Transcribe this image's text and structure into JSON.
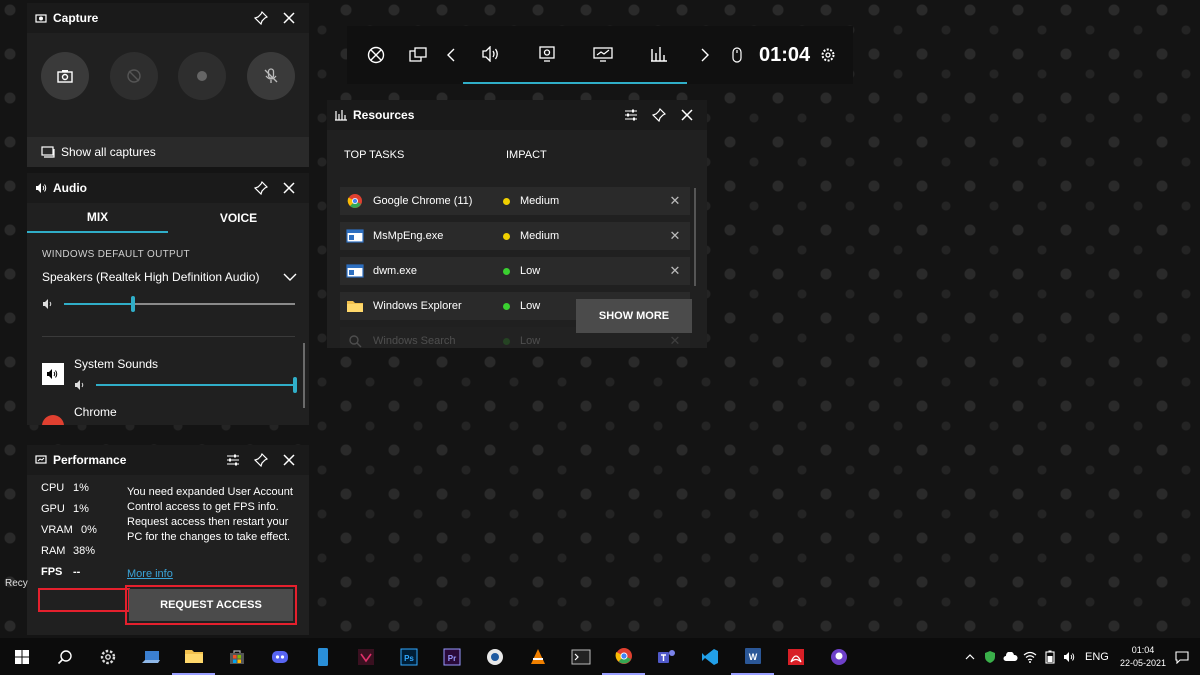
{
  "capture": {
    "title": "Capture",
    "show_all_label": "Show all captures"
  },
  "audio": {
    "title": "Audio",
    "tabs": [
      "MIX",
      "VOICE"
    ],
    "default_output_label": "WINDOWS DEFAULT OUTPUT",
    "device": "Speakers (Realtek High Definition Audio)",
    "master_volume": 0.3,
    "apps": [
      {
        "name": "System Sounds",
        "volume": 1.0
      },
      {
        "name": "Chrome"
      }
    ]
  },
  "performance": {
    "title": "Performance",
    "stats": [
      {
        "label": "CPU",
        "value": "1%"
      },
      {
        "label": "GPU",
        "value": "1%"
      },
      {
        "label": "VRAM",
        "value": "0%"
      },
      {
        "label": "RAM",
        "value": "38%"
      },
      {
        "label": "FPS",
        "value": "--"
      }
    ],
    "message": "You need expanded User Account Control access to get FPS info. Request access then restart your PC for the changes to take effect.",
    "more_info": "More info",
    "request_access": "REQUEST ACCESS"
  },
  "gamebar": {
    "time": "01:04"
  },
  "resources": {
    "title": "Resources",
    "col_tasks": "TOP TASKS",
    "col_impact": "IMPACT",
    "rows": [
      {
        "name": "Google Chrome (11)",
        "impact": "Medium",
        "color": "#f0d000"
      },
      {
        "name": "MsMpEng.exe",
        "impact": "Medium",
        "color": "#f0d000"
      },
      {
        "name": "dwm.exe",
        "impact": "Low",
        "color": "#3ad030"
      },
      {
        "name": "Windows Explorer",
        "impact": "Low",
        "color": "#3ad030"
      },
      {
        "name": "Windows Search",
        "impact": "Low",
        "color": "#3ad030"
      }
    ],
    "show_more": "SHOW MORE"
  },
  "desktop": {
    "recycle_label": "Recy"
  },
  "taskbar": {
    "language": "ENG",
    "time": "01:04",
    "date": "22-05-2021"
  },
  "colors": {
    "accent": "#30aec8",
    "highlight_box": "#e5202d"
  }
}
